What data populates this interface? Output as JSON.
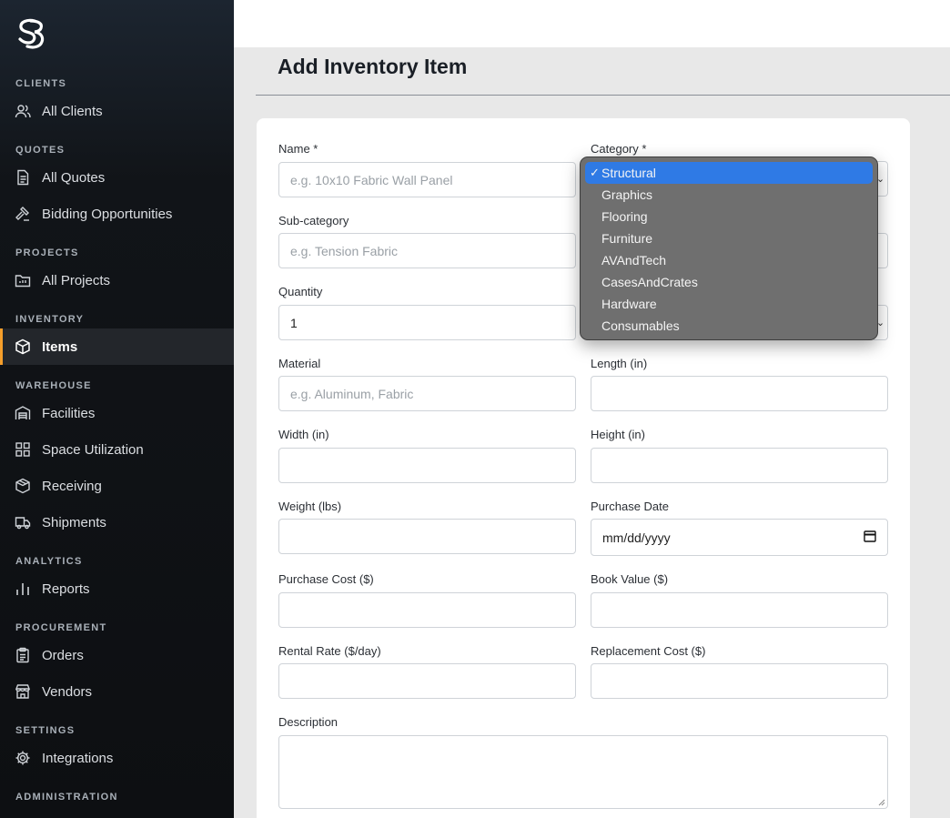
{
  "sidebar": {
    "sections": [
      {
        "title": "CLIENTS",
        "items": [
          {
            "label": "All Clients",
            "icon": "users-icon"
          }
        ]
      },
      {
        "title": "QUOTES",
        "items": [
          {
            "label": "All Quotes",
            "icon": "document-icon"
          },
          {
            "label": "Bidding Opportunities",
            "icon": "gavel-icon"
          }
        ]
      },
      {
        "title": "PROJECTS",
        "items": [
          {
            "label": "All Projects",
            "icon": "folder-icon"
          }
        ]
      },
      {
        "title": "INVENTORY",
        "items": [
          {
            "label": "Items",
            "icon": "box-icon",
            "active": true
          }
        ]
      },
      {
        "title": "WAREHOUSE",
        "items": [
          {
            "label": "Facilities",
            "icon": "warehouse-icon"
          },
          {
            "label": "Space Utilization",
            "icon": "grid-icon"
          },
          {
            "label": "Receiving",
            "icon": "package-icon"
          },
          {
            "label": "Shipments",
            "icon": "truck-icon"
          }
        ]
      },
      {
        "title": "ANALYTICS",
        "items": [
          {
            "label": "Reports",
            "icon": "bar-chart-icon"
          }
        ]
      },
      {
        "title": "PROCUREMENT",
        "items": [
          {
            "label": "Orders",
            "icon": "clipboard-icon"
          },
          {
            "label": "Vendors",
            "icon": "store-icon"
          }
        ]
      },
      {
        "title": "SETTINGS",
        "items": [
          {
            "label": "Integrations",
            "icon": "gear-icon"
          }
        ]
      },
      {
        "title": "ADMINISTRATION",
        "items": []
      }
    ]
  },
  "page": {
    "title": "Add Inventory Item"
  },
  "form": {
    "name_label": "Name *",
    "name_placeholder": "e.g. 10x10 Fabric Wall Panel",
    "category_label": "Category *",
    "subcategory_label": "Sub-category",
    "subcategory_placeholder": "e.g. Tension Fabric",
    "quantity_label": "Quantity",
    "quantity_value": "1",
    "material_label": "Material",
    "material_placeholder": "e.g. Aluminum, Fabric",
    "length_label": "Length (in)",
    "width_label": "Width (in)",
    "height_label": "Height (in)",
    "weight_label": "Weight (lbs)",
    "purchase_date_label": "Purchase Date",
    "purchase_date_placeholder": "mm/dd/yyyy",
    "purchase_cost_label": "Purchase Cost ($)",
    "book_value_label": "Book Value ($)",
    "rental_rate_label": "Rental Rate ($/day)",
    "replacement_cost_label": "Replacement Cost ($)",
    "description_label": "Description"
  },
  "category_dropdown": {
    "selected": "Structural",
    "check": "✓",
    "options": [
      "Structural",
      "Graphics",
      "Flooring",
      "Furniture",
      "AVAndTech",
      "CasesAndCrates",
      "Hardware",
      "Consumables"
    ]
  }
}
